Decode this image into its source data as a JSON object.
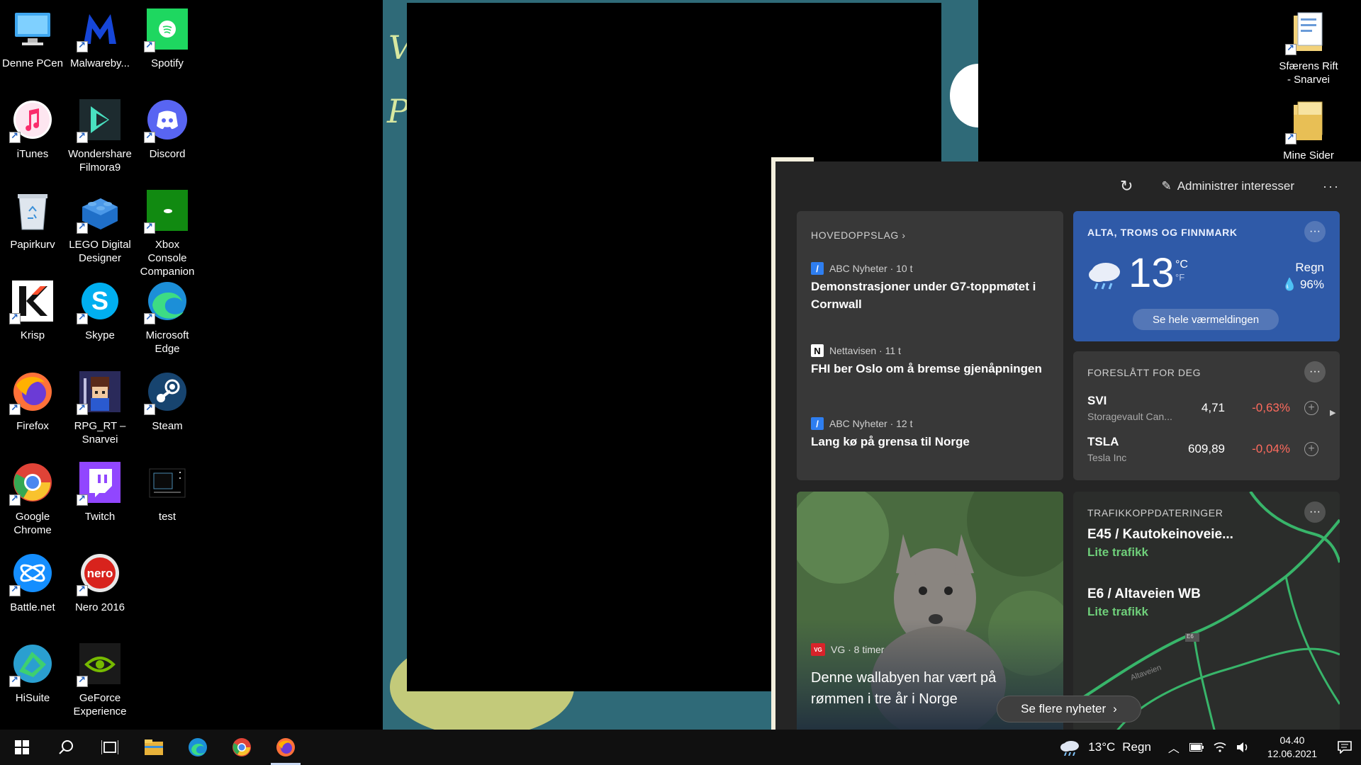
{
  "desktop": {
    "left_icons": [
      {
        "label": "Denne PCen",
        "icon": "computer-icon",
        "shortcut": false
      },
      {
        "label": "Malwareby...",
        "icon": "malwarebytes-icon",
        "shortcut": true
      },
      {
        "label": "Spotify",
        "icon": "spotify-icon",
        "shortcut": true
      },
      {
        "label": "iTunes",
        "icon": "itunes-icon",
        "shortcut": true
      },
      {
        "label": "Wondershare Filmora9",
        "icon": "filmora-icon",
        "shortcut": true
      },
      {
        "label": "Discord",
        "icon": "discord-icon",
        "shortcut": true
      },
      {
        "label": "Papirkurv",
        "icon": "recycle-bin-icon",
        "shortcut": false
      },
      {
        "label": "LEGO Digital Designer",
        "icon": "lego-icon",
        "shortcut": true
      },
      {
        "label": "Xbox Console Companion",
        "icon": "xbox-icon",
        "shortcut": true
      },
      {
        "label": "Krisp",
        "icon": "krisp-icon",
        "shortcut": true
      },
      {
        "label": "Skype",
        "icon": "skype-icon",
        "shortcut": true
      },
      {
        "label": "Microsoft Edge",
        "icon": "edge-icon",
        "shortcut": true
      },
      {
        "label": "Firefox",
        "icon": "firefox-icon",
        "shortcut": true
      },
      {
        "label": "RPG_RT – Snarvei",
        "icon": "rpg-icon",
        "shortcut": true
      },
      {
        "label": "Steam",
        "icon": "steam-icon",
        "shortcut": true
      },
      {
        "label": "Google Chrome",
        "icon": "chrome-icon",
        "shortcut": true
      },
      {
        "label": "Twitch",
        "icon": "twitch-icon",
        "shortcut": true
      },
      {
        "label": "test",
        "icon": "test-file-icon",
        "shortcut": false
      },
      {
        "label": "Battle.net",
        "icon": "battlenet-icon",
        "shortcut": true
      },
      {
        "label": "Nero 2016",
        "icon": "nero-icon",
        "shortcut": true
      },
      {
        "label": "HiSuite",
        "icon": "hisuite-icon",
        "shortcut": true
      },
      {
        "label": "GeForce Experience",
        "icon": "geforce-icon",
        "shortcut": true
      }
    ],
    "right_icons": [
      {
        "label": "Sfærens Rift - Snarvei",
        "icon": "folder-shortcut-icon"
      },
      {
        "label": "Mine Sider",
        "icon": "folder-icon"
      }
    ]
  },
  "news_panel": {
    "manage_label": "Administrer interesser",
    "top_stories": {
      "title": "HOVEDOPPSLAG",
      "items": [
        {
          "source": "ABC Nyheter · 10 t",
          "logo": "/",
          "headline": "Demonstrasjoner under G7-toppmøtet i Cornwall"
        },
        {
          "source": "Nettavisen · 11 t",
          "logo": "N",
          "headline": "FHI ber Oslo om å bremse gjenåpningen"
        },
        {
          "source": "ABC Nyheter · 12 t",
          "logo": "/",
          "headline": "Lang kø på grensa til Norge"
        }
      ]
    },
    "weather": {
      "location": "ALTA, TROMS OG FINNMARK",
      "temperature": "13",
      "unit_c": "°C",
      "unit_f": "°F",
      "condition": "Regn",
      "precipitation": "96%",
      "button": "Se hele værmeldingen"
    },
    "stocks": {
      "title": "FORESLÅTT FOR DEG",
      "rows": [
        {
          "symbol": "SVI",
          "name": "Storagevault Can...",
          "price": "4,71",
          "change": "-0,63%"
        },
        {
          "symbol": "TSLA",
          "name": "Tesla Inc",
          "price": "609,89",
          "change": "-0,04%"
        }
      ],
      "negative_color": "#ff6b5e"
    },
    "feature_story": {
      "source": "VG · 8 timer",
      "logo": "VG",
      "headline": "Denne wallabyen har vært på rømmen i tre år i Norge"
    },
    "traffic": {
      "title": "TRAFIKKOPPDATERINGER",
      "routes": [
        {
          "name": "E45 / Kautokeinoveie...",
          "status": "Lite trafikk"
        },
        {
          "name": "E6 / Altaveien WB",
          "status": "Lite trafikk"
        }
      ],
      "map_labels": [
        "E6",
        "Altaveien"
      ],
      "status_color": "#6fcf7a"
    },
    "see_more": "Se flere nyheter"
  },
  "taskbar": {
    "weather_temp": "13°C",
    "weather_text": "Regn",
    "time": "04.40",
    "date": "12.06.2021",
    "apps": [
      "start-icon",
      "search-icon",
      "task-view-icon",
      "file-explorer-icon",
      "edge-icon",
      "chrome-icon",
      "firefox-icon"
    ]
  }
}
